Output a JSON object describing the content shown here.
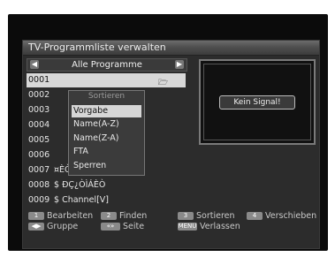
{
  "window_title": "TV-Programmliste verwalten",
  "list": {
    "group_label": "Alle Programme",
    "prev_icon": "arrow-left-icon",
    "next_icon": "arrow-right-icon",
    "rows": [
      {
        "num": "0001",
        "name": ""
      },
      {
        "num": "0002",
        "name": ""
      },
      {
        "num": "0003",
        "name": ""
      },
      {
        "num": "0004",
        "name": ""
      },
      {
        "num": "0005",
        "name": ""
      },
      {
        "num": "0006",
        "name": ""
      },
      {
        "num": "0007",
        "name": "¤ÈÒÏÂ"
      },
      {
        "num": "0008",
        "name": "$ ÐÇ¿ÒÌÁÈÒ"
      },
      {
        "num": "0009",
        "name": "$ Channel[V]"
      }
    ]
  },
  "popup": {
    "title": "Sortieren",
    "options": [
      "Vorgabe",
      "Name(A-Z)",
      "Name(Z-A)",
      "FTA",
      "Sperren"
    ],
    "selected_index": 0
  },
  "preview": {
    "no_signal": "Kein Signal!"
  },
  "help": {
    "edit_key": "1",
    "edit_label": "Bearbeiten",
    "find_key": "2",
    "find_label": "Finden",
    "sort_key": "3",
    "sort_label": "Sortieren",
    "move_key": "4",
    "move_label": "Verschieben",
    "group_key": "◀▶",
    "group_label": "Gruppe",
    "page_key": "«»",
    "page_label": "Seite",
    "exit_key": "MENU",
    "exit_label": "Verlassen"
  }
}
